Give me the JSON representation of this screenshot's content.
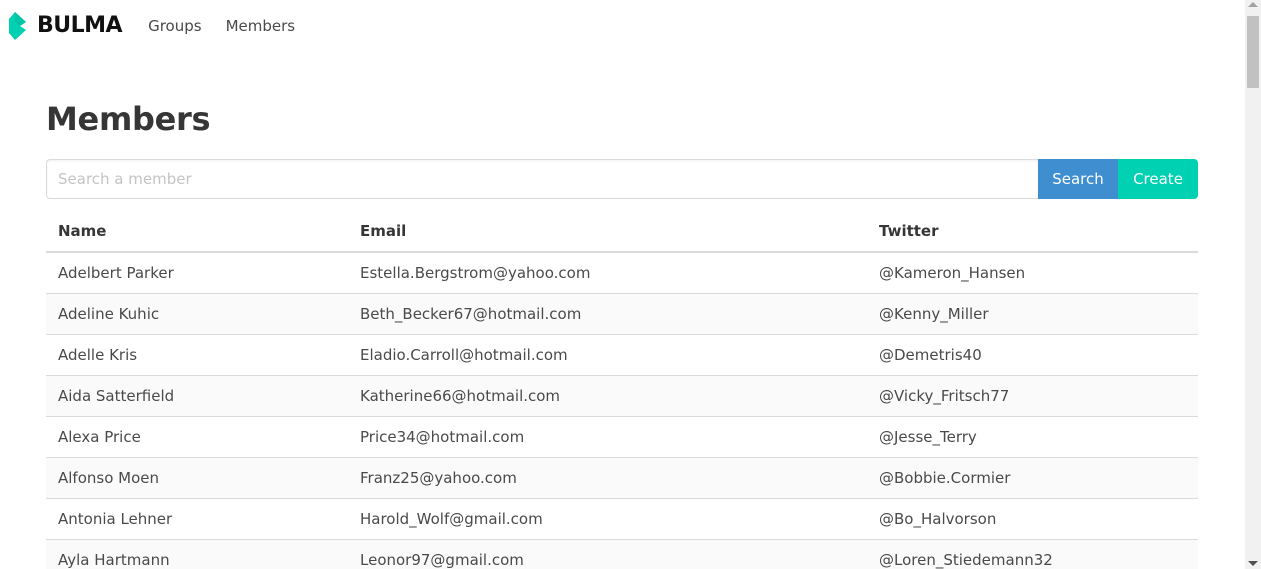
{
  "navbar": {
    "brand_icon": "bulma-logo-icon",
    "brand_text": "BULMA",
    "items": [
      {
        "label": "Groups"
      },
      {
        "label": "Members"
      }
    ]
  },
  "page": {
    "title": "Members"
  },
  "search": {
    "placeholder": "Search a member",
    "value": "",
    "search_label": "Search",
    "create_label": "Create"
  },
  "table": {
    "columns": [
      "Name",
      "Email",
      "Twitter"
    ],
    "rows": [
      [
        "Adelbert Parker",
        "Estella.Bergstrom@yahoo.com",
        "@Kameron_Hansen"
      ],
      [
        "Adeline Kuhic",
        "Beth_Becker67@hotmail.com",
        "@Kenny_Miller"
      ],
      [
        "Adelle Kris",
        "Eladio.Carroll@hotmail.com",
        "@Demetris40"
      ],
      [
        "Aida Satterfield",
        "Katherine66@hotmail.com",
        "@Vicky_Fritsch77"
      ],
      [
        "Alexa Price",
        "Price34@hotmail.com",
        "@Jesse_Terry"
      ],
      [
        "Alfonso Moen",
        "Franz25@yahoo.com",
        "@Bobbie.Cormier"
      ],
      [
        "Antonia Lehner",
        "Harold_Wolf@gmail.com",
        "@Bo_Halvorson"
      ],
      [
        "Ayla Hartmann",
        "Leonor97@gmail.com",
        "@Loren_Stiedemann32"
      ]
    ]
  },
  "colors": {
    "brand": "#00d1b2",
    "info": "#3e8ed0",
    "primary": "#00d1b2"
  }
}
